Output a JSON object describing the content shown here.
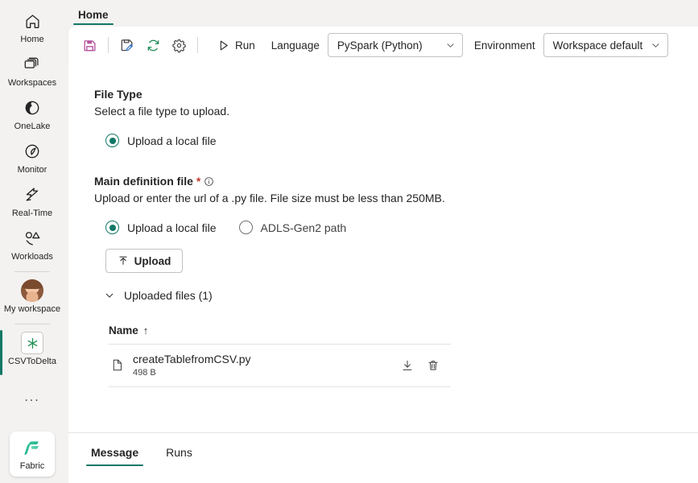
{
  "rail": {
    "items": [
      {
        "label": "Home",
        "icon": "home-icon",
        "selected": false
      },
      {
        "label": "Workspaces",
        "icon": "workspaces-icon",
        "selected": false
      },
      {
        "label": "OneLake",
        "icon": "onelake-icon",
        "selected": false
      },
      {
        "label": "Monitor",
        "icon": "monitor-icon",
        "selected": false
      },
      {
        "label": "Real-Time",
        "icon": "real-time-icon",
        "selected": false
      },
      {
        "label": "Workloads",
        "icon": "workloads-icon",
        "selected": false
      }
    ],
    "my_workspace": {
      "label": "My workspace",
      "icon": "avatar"
    },
    "active_item": {
      "label": "CSVToDelta",
      "icon": "spark-job-definition-icon",
      "selected": true
    },
    "more_label": "...",
    "fabric": {
      "label": "Fabric",
      "icon": "fabric-logo"
    }
  },
  "ribbon": {
    "tab": "Home",
    "save_label": "Save",
    "save_as_label": "Save as",
    "refresh_label": "Refresh",
    "settings_label": "Settings",
    "run_label": "Run",
    "language_label": "Language",
    "language_value": "PySpark (Python)",
    "environment_label": "Environment",
    "environment_value": "Workspace default"
  },
  "main": {
    "file_type": {
      "title": "File Type",
      "description": "Select a file type to upload.",
      "option_label": "Upload a local file"
    },
    "main_definition": {
      "title": "Main definition file",
      "required_mark": "*",
      "description": "Upload or enter the url of a .py file. File size must be less than 250MB.",
      "options": [
        {
          "label": "Upload a local file",
          "selected": true
        },
        {
          "label": "ADLS-Gen2 path",
          "selected": false
        }
      ],
      "upload_button": "Upload"
    },
    "uploaded": {
      "collapse_label": "Uploaded files (1)",
      "column_name": "Name",
      "sort_indicator": "↑",
      "rows": [
        {
          "name": "createTablefromCSV.py",
          "size": "498 B",
          "download": "Download",
          "delete": "Delete"
        }
      ]
    }
  },
  "bottom": {
    "tabs": [
      {
        "label": "Message",
        "active": true
      },
      {
        "label": "Runs",
        "active": false
      }
    ]
  },
  "colors": {
    "accent": "#117865",
    "save_icon": "#b4529e",
    "refresh_icon": "#1a8a55",
    "pencil_icon": "#2f6ec4",
    "required": "#c0392b",
    "rail_bg": "#f3f2f1",
    "surface": "#ffffff"
  }
}
